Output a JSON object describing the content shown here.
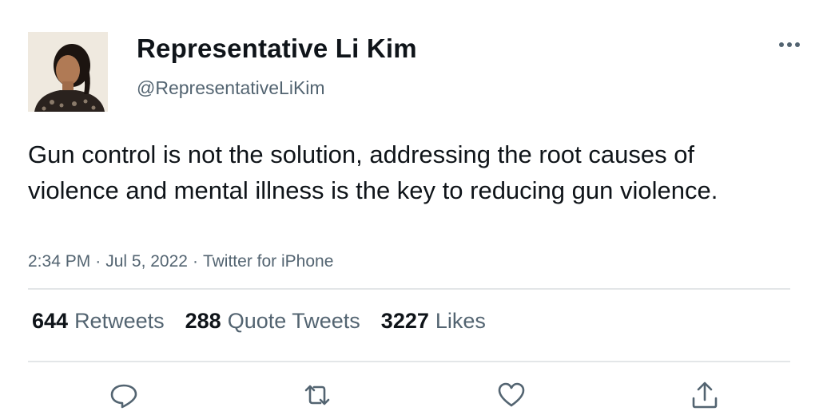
{
  "author": {
    "display_name": "Representative Li Kim",
    "handle": "@RepresentativeLiKim"
  },
  "tweet": {
    "text": "Gun control is not the solution, addressing the root causes of violence and mental illness is the key to reducing gun violence.",
    "time": "2:34 PM",
    "date": "Jul 5, 2022",
    "source": "Twitter for iPhone",
    "separator": "·"
  },
  "stats": {
    "retweets": {
      "count": "644",
      "label": "Retweets"
    },
    "quote_tweets": {
      "count": "288",
      "label": "Quote Tweets"
    },
    "likes": {
      "count": "3227",
      "label": "Likes"
    }
  },
  "icons": {
    "more": "more-horizontal-icon",
    "reply": "reply-icon",
    "retweet": "retweet-icon",
    "like": "heart-icon",
    "share": "share-icon"
  },
  "colors": {
    "text_primary": "#0f1419",
    "text_secondary": "#536471",
    "divider": "#e3e6e8"
  }
}
